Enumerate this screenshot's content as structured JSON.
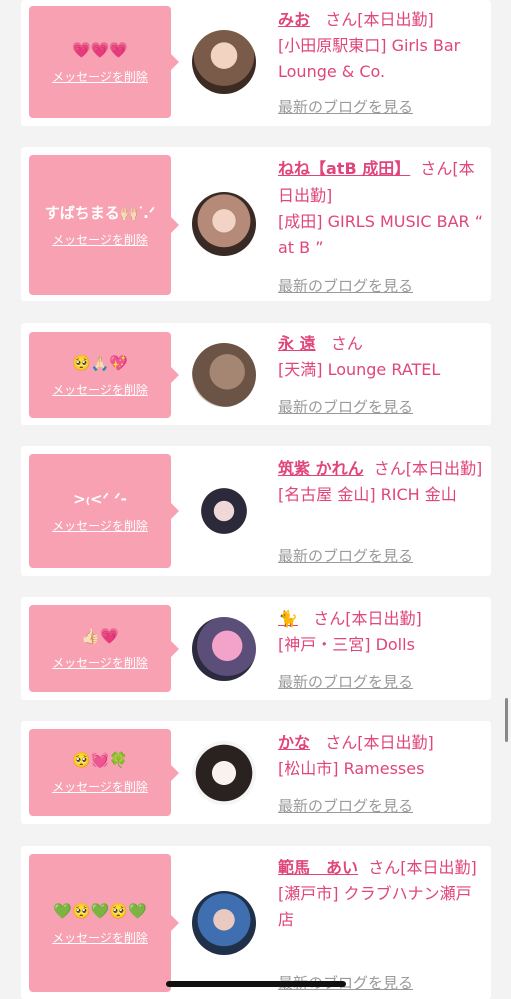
{
  "common": {
    "delete_label": "メッセージを削除",
    "blog_label": "最新のブログを見る",
    "san_label": "さん"
  },
  "cards": [
    {
      "message": "💗💗💗",
      "name": "みお",
      "status": "[本日出勤]",
      "shop": "[小田原駅東口] Girls Bar Lounge & Co."
    },
    {
      "message": "すばちまる🙌🏻ᐝ.ᐟ",
      "name": "ねね【atB 成田】",
      "status": "[本日出勤]",
      "shop": "[成田] GIRLS MUSIC BAR “ at B ”"
    },
    {
      "message": "🥺🙏🏻💖",
      "name": "永 遠",
      "status": "",
      "shop": "[天満] Lounge RATEL"
    },
    {
      "message": ">₍<ᐟ ᐟ-",
      "name": "筑紫 かれん",
      "status": "[本日出勤]",
      "shop": "[名古屋 金山] RICH 金山"
    },
    {
      "message": "👍🏻💗",
      "name": "🐈",
      "status": "[本日出勤]",
      "shop": "[神戸・三宮] Dolls"
    },
    {
      "message": "🥺💓🍀",
      "name": "かな",
      "status": "[本日出勤]",
      "shop": "[松山市] Ramesses"
    },
    {
      "message": "💚🥺💚🥺💚",
      "name": "範馬　あい",
      "status": "[本日出勤]",
      "shop": "[瀬戸市] クラブハナン瀬戸店"
    }
  ],
  "colors": {
    "accent": "#e0457b",
    "bubble": "#f7a1b2",
    "muted": "#9a9a9a"
  }
}
